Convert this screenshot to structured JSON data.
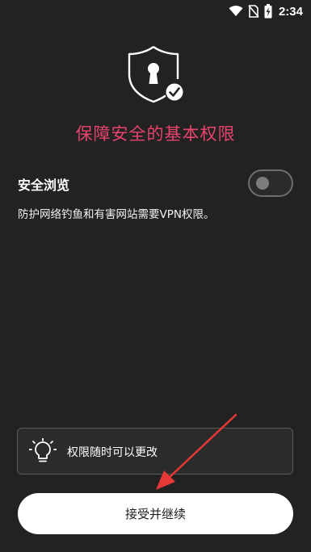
{
  "status_bar": {
    "time": "2:34",
    "icons": [
      "wifi-icon",
      "no-sim-icon",
      "battery-charging-icon"
    ]
  },
  "header": {
    "icon": "shield-lock-check-icon",
    "title": "保障安全的基本权限"
  },
  "setting": {
    "title": "安全浏览",
    "description": "防护网络钓鱼和有害网站需要VPN权限。",
    "enabled": false
  },
  "tip": {
    "icon": "lightbulb-icon",
    "text": "权限随时可以更改"
  },
  "primary_button": {
    "label": "接受并继续"
  },
  "annotation": {
    "icon": "red-arrow-icon",
    "color": "#e53935"
  },
  "colors": {
    "background": "#222222",
    "accent": "#e8436d",
    "button_bg": "#ffffff"
  }
}
